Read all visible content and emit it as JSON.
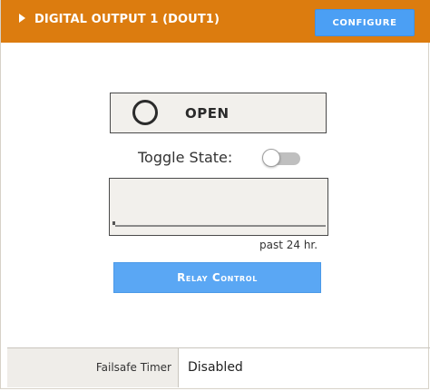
{
  "header": {
    "title": "DIGITAL OUTPUT 1 (DOUT1)",
    "configure_label": "CONFIGURE",
    "bg_color": "#dc7c0f",
    "caret_icon": "triangle-right-icon"
  },
  "state": {
    "icon": "circle-outline-icon",
    "label": "OPEN"
  },
  "toggle": {
    "label": "Toggle State:",
    "checked": false
  },
  "history": {
    "caption": "past 24 hr."
  },
  "relay": {
    "button_label": "Relay Control"
  },
  "failsafe": {
    "label": "Failsafe Timer",
    "value": "Disabled"
  },
  "colors": {
    "accent": "#4b9ff4",
    "header": "#dc7c0f",
    "panel_bg": "#f2f0ec"
  }
}
